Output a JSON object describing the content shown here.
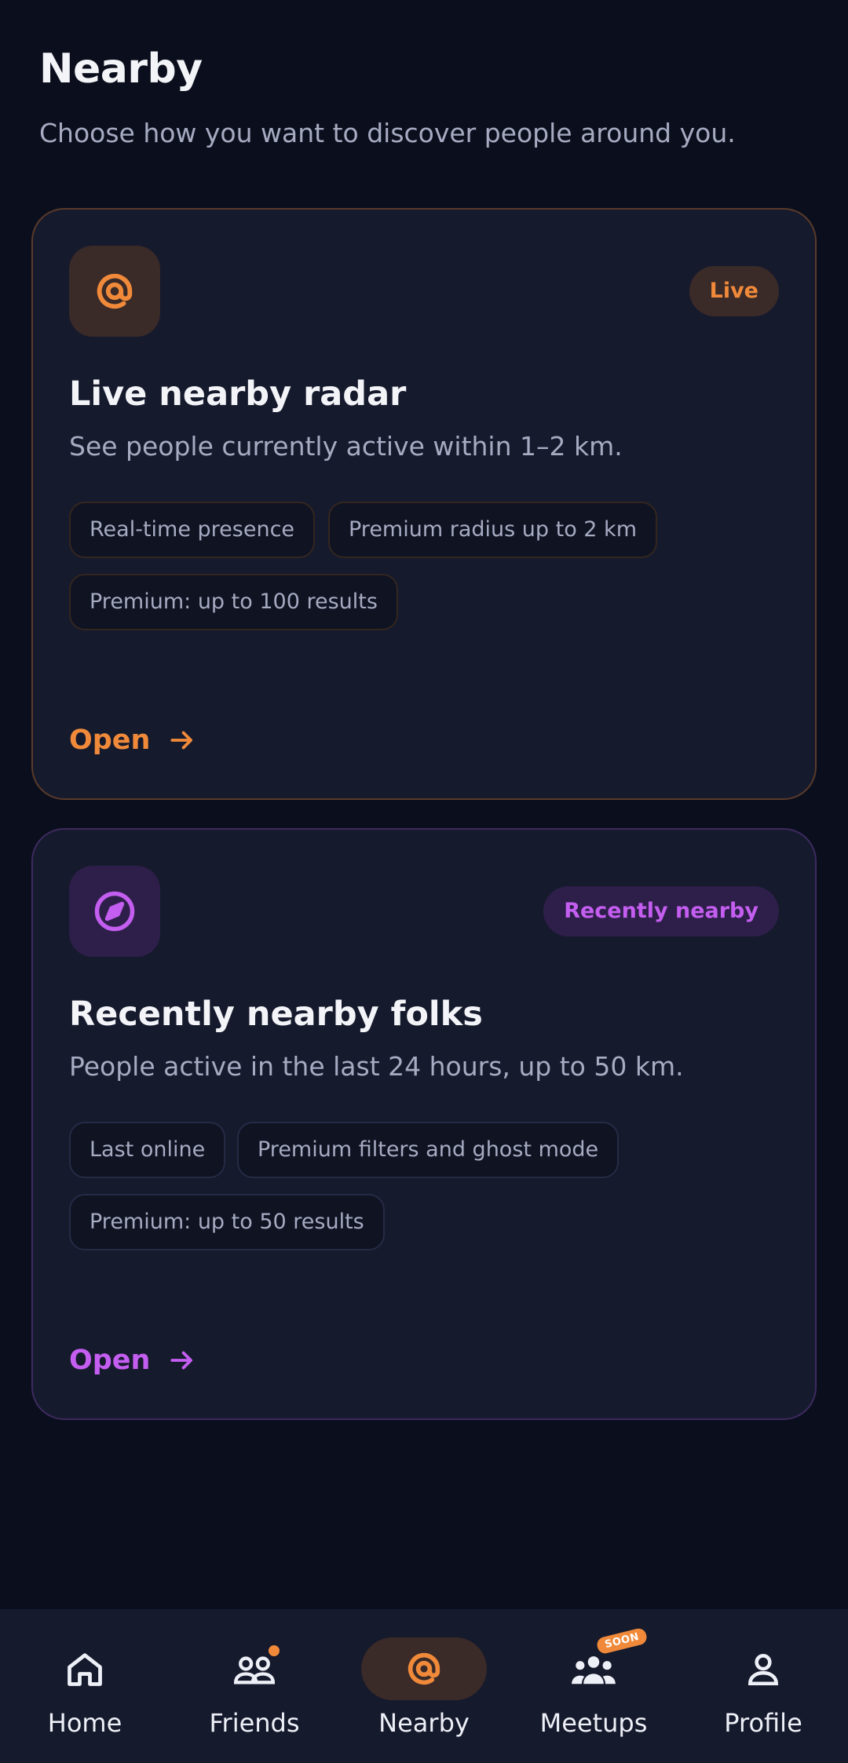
{
  "header": {
    "title": "Nearby",
    "subtitle": "Choose how you want to discover people around you."
  },
  "cards": [
    {
      "icon": "radar-at-icon",
      "badge": "Live",
      "title": "Live nearby radar",
      "description": "See people currently active within 1–2 km.",
      "chips": [
        "Real-time presence",
        "Premium radius up to 2 km",
        "Premium: up to 100 results"
      ],
      "open_label": "Open",
      "accent": "#f08a3a"
    },
    {
      "icon": "compass-icon",
      "badge": "Recently nearby",
      "title": "Recently nearby folks",
      "description": "People active in the last 24 hours, up to 50 km.",
      "chips": [
        "Last online",
        "Premium filters and ghost mode",
        "Premium: up to 50 results"
      ],
      "open_label": "Open",
      "accent": "#c45ef0"
    }
  ],
  "nav": {
    "items": [
      {
        "label": "Home",
        "icon": "home-icon"
      },
      {
        "label": "Friends",
        "icon": "friends-icon"
      },
      {
        "label": "Nearby",
        "icon": "radar-at-icon",
        "active": true
      },
      {
        "label": "Meetups",
        "icon": "meetups-icon",
        "badge": "SOON"
      },
      {
        "label": "Profile",
        "icon": "profile-icon"
      }
    ]
  }
}
